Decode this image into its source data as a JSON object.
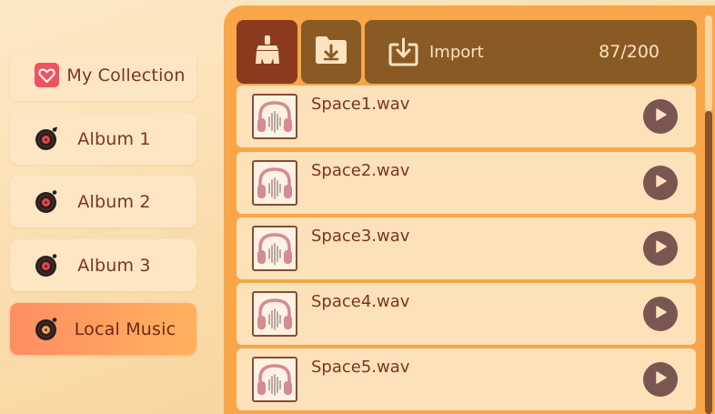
{
  "sidebar": {
    "items": [
      {
        "label": "My Collection",
        "icon": "heart-icon",
        "active": false
      },
      {
        "label": "Album  1",
        "icon": "vinyl-record-icon",
        "active": false
      },
      {
        "label": "Album  2",
        "icon": "vinyl-record-icon",
        "active": false
      },
      {
        "label": "Album  3",
        "icon": "vinyl-record-icon",
        "active": false
      },
      {
        "label": "Local Music",
        "icon": "vinyl-record-icon",
        "active": true
      }
    ]
  },
  "toolbar": {
    "clean_icon": "broom-icon",
    "download_icon": "folder-download-icon",
    "import_label": "Import",
    "import_icon": "download-tray-icon",
    "count": "87/200"
  },
  "tracks": [
    {
      "title": "Space1.wav"
    },
    {
      "title": "Space2.wav"
    },
    {
      "title": "Space3.wav"
    },
    {
      "title": "Space4.wav"
    },
    {
      "title": "Space5.wav"
    }
  ],
  "colors": {
    "panel": "#f8a649",
    "active_nav": "#ff8d62",
    "toolbar_dark": "#8a5a24",
    "clean_button": "#8b3a20",
    "play_button": "#7a5551"
  }
}
